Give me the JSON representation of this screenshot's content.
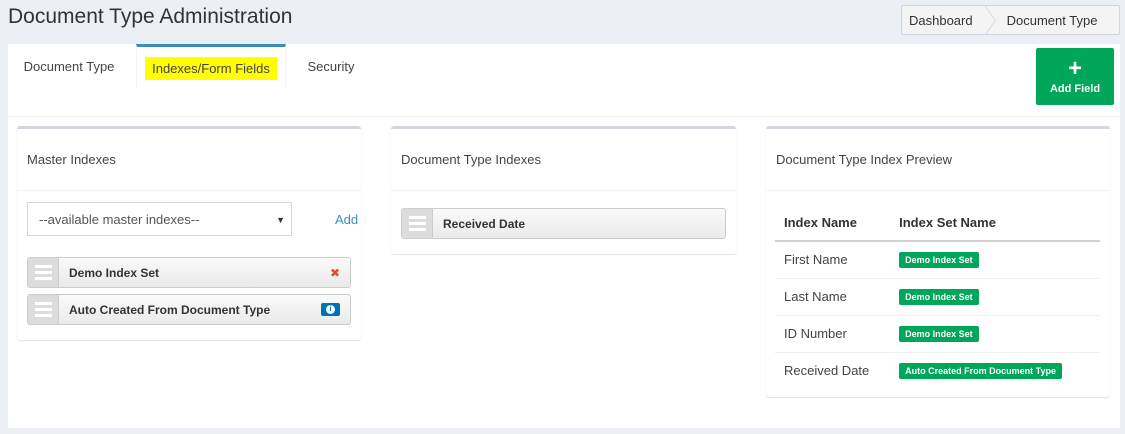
{
  "page": {
    "title": "Document Type Administration"
  },
  "breadcrumb": [
    {
      "label": "Dashboard"
    },
    {
      "label": "Document Type"
    }
  ],
  "tabs": [
    {
      "label": "Document Type",
      "active": false
    },
    {
      "label": "Indexes/Form Fields",
      "active": true
    },
    {
      "label": "Security",
      "active": false
    }
  ],
  "add_field": {
    "label": "Add Field",
    "icon": "plus-icon"
  },
  "master_indexes": {
    "title": "Master Indexes",
    "select_value": "--available master indexes--",
    "add_label": "Add",
    "items": [
      {
        "label": "Demo Index Set",
        "action_icon": "remove-icon"
      },
      {
        "label": "Auto Created From Document Type",
        "action_icon": "info-icon"
      }
    ]
  },
  "document_type_indexes": {
    "title": "Document Type Indexes",
    "items": [
      {
        "label": "Received Date"
      }
    ]
  },
  "preview": {
    "title": "Document Type Index Preview",
    "columns": [
      "Index Name",
      "Index Set Name"
    ],
    "rows": [
      {
        "index_name": "First Name",
        "index_set": "Demo Index Set"
      },
      {
        "index_name": "Last Name",
        "index_set": "Demo Index Set"
      },
      {
        "index_name": "ID Number",
        "index_set": "Demo Index Set"
      },
      {
        "index_name": "Received Date",
        "index_set": "Auto Created From Document Type"
      }
    ]
  },
  "colors": {
    "accent": "#3c8dbc",
    "success": "#00a65a",
    "danger": "#dd4b39",
    "info": "#0073b7",
    "highlight": "#ffff00"
  }
}
